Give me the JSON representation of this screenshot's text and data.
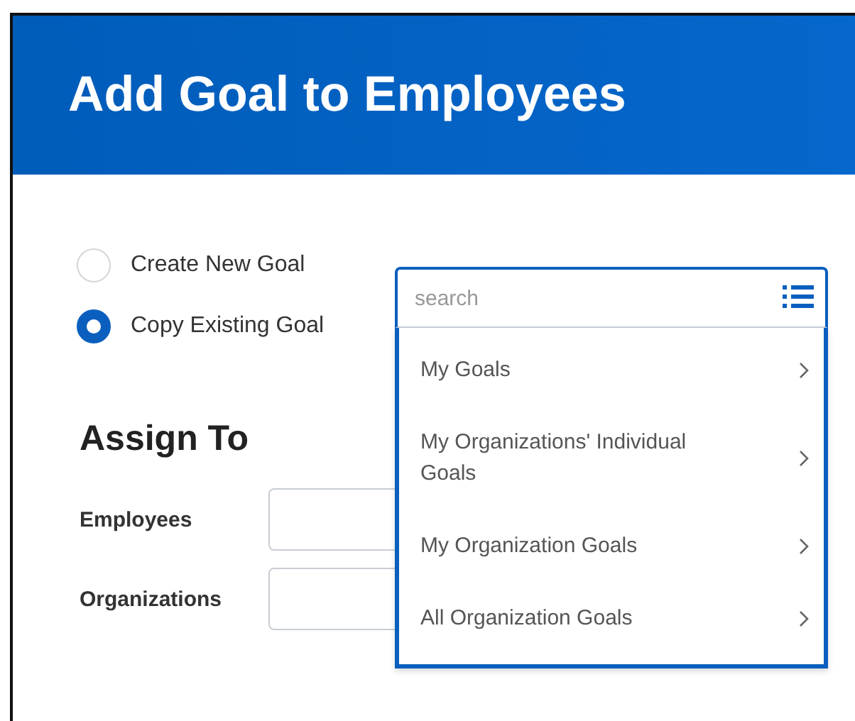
{
  "header": {
    "title": "Add Goal to Employees"
  },
  "options": [
    {
      "label": "Create New Goal",
      "selected": false
    },
    {
      "label": "Copy Existing Goal",
      "selected": true
    }
  ],
  "goal_search": {
    "placeholder": "search"
  },
  "dropdown": {
    "items": [
      {
        "label": "My Goals"
      },
      {
        "label": "My Organizations' Individual Goals"
      },
      {
        "label": "My Organization Goals"
      },
      {
        "label": "All Organization Goals"
      }
    ]
  },
  "assign_to": {
    "heading": "Assign To",
    "fields": [
      {
        "label": "Employees"
      },
      {
        "label": "Organizations"
      }
    ]
  }
}
